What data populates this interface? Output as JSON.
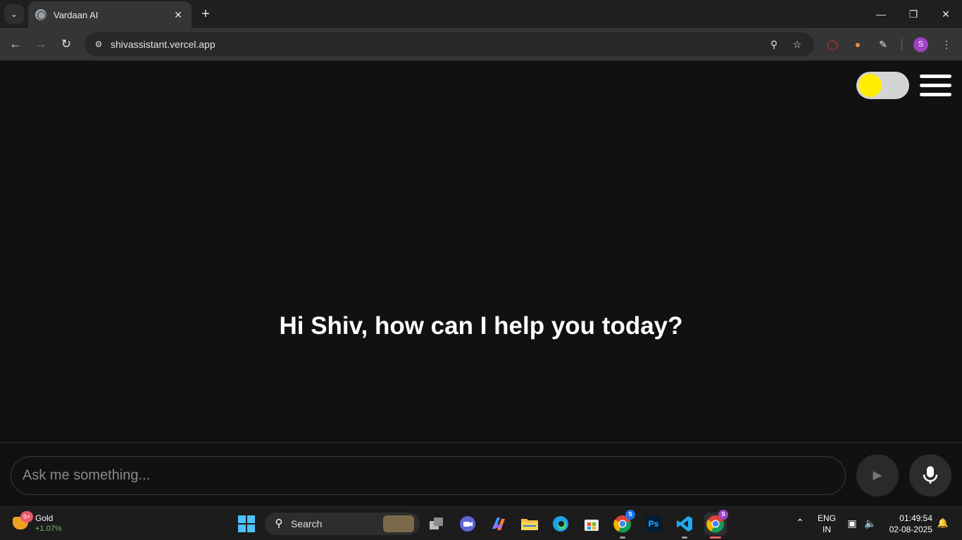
{
  "browser": {
    "tab_title": "Vardaan AI",
    "url": "shivassistant.vercel.app",
    "profile_initial": "S"
  },
  "page": {
    "greeting": "Hi Shiv, how can I help you today?",
    "input_placeholder": "Ask me something...",
    "theme_toggle_knob_color": "#ffee00"
  },
  "taskbar": {
    "widget": {
      "badge": "9+",
      "title": "Gold",
      "change": "+1.07%"
    },
    "search_label": "Search",
    "apps": [
      "task-view",
      "teams-meet",
      "copilot",
      "file-explorer",
      "edge",
      "microsoft-store",
      "chrome",
      "photoshop",
      "vscode",
      "chrome-profile"
    ],
    "chrome_badge": "S",
    "active_chrome_badge": "S",
    "photoshop_label": "Ps",
    "lang_line1": "ENG",
    "lang_line2": "IN",
    "time": "01:49:54",
    "date": "02-08-2025"
  },
  "colors": {
    "page_bg": "#111111",
    "accent_toggle": "#ffee00",
    "profile_avatar": "#a142c3"
  }
}
